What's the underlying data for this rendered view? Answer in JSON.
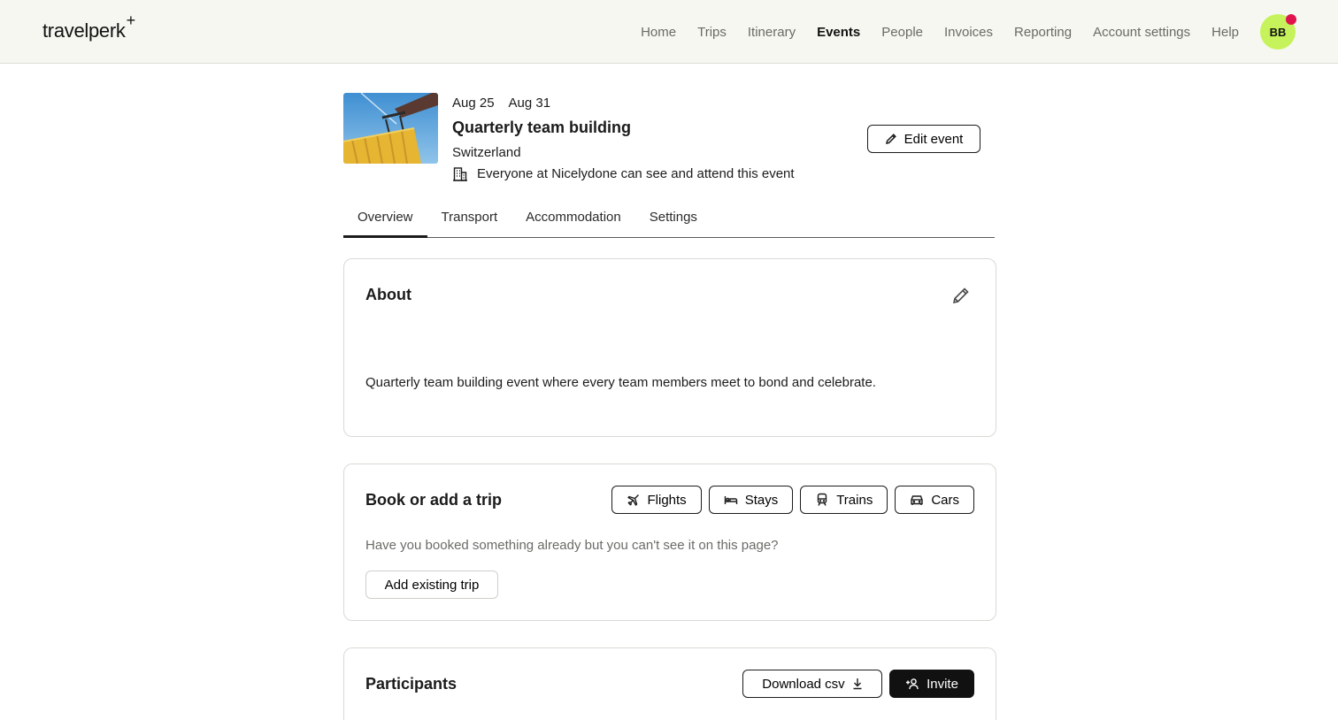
{
  "app": {
    "logo_text": "travelperk",
    "logo_mark": "+"
  },
  "nav": {
    "items": [
      {
        "label": "Home"
      },
      {
        "label": "Trips"
      },
      {
        "label": "Itinerary"
      },
      {
        "label": "Events",
        "active": true
      },
      {
        "label": "People"
      },
      {
        "label": "Invoices"
      },
      {
        "label": "Reporting"
      },
      {
        "label": "Account settings"
      },
      {
        "label": "Help"
      }
    ],
    "avatar_initials": "BB",
    "avatar_color": "#c6f35b",
    "notification_color": "#e0134c"
  },
  "event": {
    "start_date": "Aug 25",
    "end_date": "Aug 31",
    "title": "Quarterly team building",
    "location": "Switzerland",
    "visibility": "Everyone at Nicelydone can see and attend this event",
    "edit_label": "Edit event"
  },
  "tabs": [
    {
      "label": "Overview",
      "active": true
    },
    {
      "label": "Transport"
    },
    {
      "label": "Accommodation"
    },
    {
      "label": "Settings"
    }
  ],
  "about": {
    "title": "About",
    "description": "Quarterly team building event where every team members meet to bond and celebrate."
  },
  "book": {
    "title": "Book or add a trip",
    "buttons": {
      "flights": "Flights",
      "stays": "Stays",
      "trains": "Trains",
      "cars": "Cars"
    },
    "hint": "Have you booked something already but you can't see it on this page?",
    "add_existing_label": "Add existing trip"
  },
  "participants": {
    "title": "Participants",
    "download_label": "Download csv",
    "invite_label": "Invite"
  }
}
